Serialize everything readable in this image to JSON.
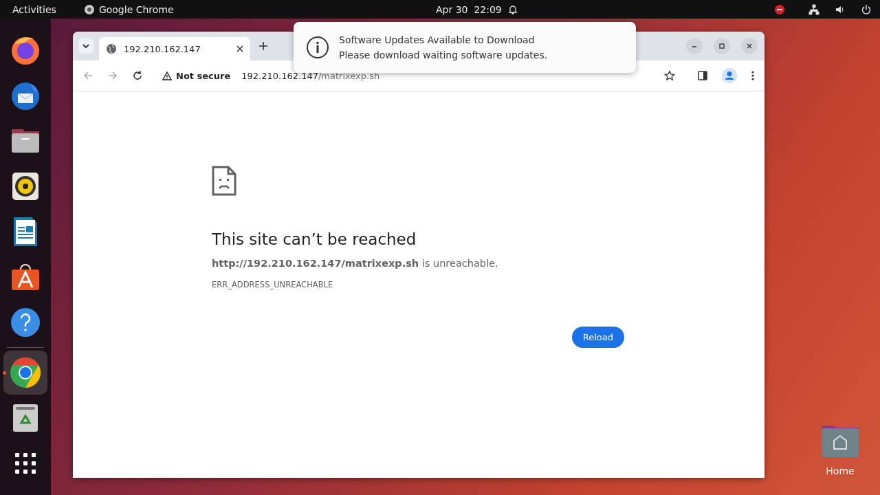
{
  "top_bar": {
    "activities": "Activities",
    "app": "Google Chrome",
    "date": "Apr 30",
    "time": "22:09"
  },
  "dock": [
    {
      "kind": "firefox",
      "selected": false,
      "running": false
    },
    {
      "kind": "mail",
      "selected": false,
      "running": false
    },
    {
      "kind": "files",
      "selected": false,
      "running": false
    },
    {
      "kind": "music",
      "selected": false,
      "running": false
    },
    {
      "kind": "writer",
      "selected": false,
      "running": false
    },
    {
      "kind": "store",
      "selected": false,
      "running": false
    },
    {
      "kind": "help",
      "selected": false,
      "running": false
    },
    {
      "kind": "separator"
    },
    {
      "kind": "chrome",
      "selected": true,
      "running": true
    },
    {
      "kind": "trash",
      "selected": false,
      "running": false
    },
    {
      "kind": "apps",
      "selected": false,
      "running": false
    }
  ],
  "browser": {
    "tabs": [
      {
        "title": "192.210.162.147",
        "selected": true
      }
    ],
    "address": {
      "security": "Not secure",
      "host": "192.210.162.147",
      "path": "/matrixexp.sh"
    },
    "error": {
      "title": "This site can’t be reached",
      "message": "**http://192.210.162.147/matrixexp.sh** is unreachable.",
      "code": "ERR_ADDRESS_UNREACHABLE",
      "button": "Reload"
    }
  },
  "notification": {
    "title": "Software Updates Available to Download",
    "body": "Please download waiting software updates."
  },
  "desktop_icons": [
    {
      "label": "Home"
    }
  ]
}
